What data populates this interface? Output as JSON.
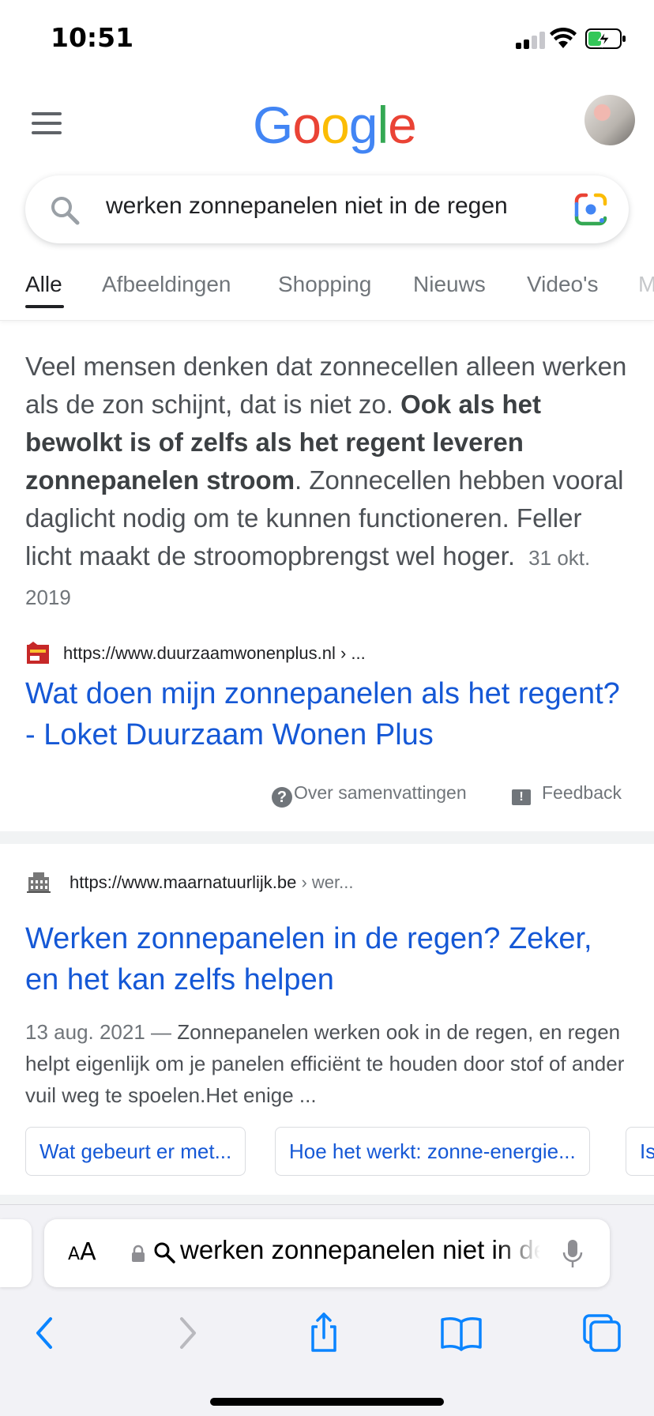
{
  "status_bar": {
    "time": "10:51"
  },
  "header": {
    "logo_letters": [
      {
        "char": "G",
        "color": "#4285f4"
      },
      {
        "char": "o",
        "color": "#ea4335"
      },
      {
        "char": "o",
        "color": "#fbbc05"
      },
      {
        "char": "g",
        "color": "#4285f4"
      },
      {
        "char": "l",
        "color": "#34a853"
      },
      {
        "char": "e",
        "color": "#ea4335"
      }
    ]
  },
  "search": {
    "query": "werken zonnepanelen niet in de regen"
  },
  "tabs": [
    "Alle",
    "Afbeeldingen",
    "Shopping",
    "Nieuws",
    "Video's",
    "M"
  ],
  "featured_snippet": {
    "text_before": "Veel mensen denken dat zonnecellen alleen werken als de zon schijnt, dat is niet zo. ",
    "bold": "Ook als het bewolkt is of zelfs als het regent leveren zonnepanelen stroom",
    "text_after": ". Zonnecellen hebben vooral daglicht nodig om te kunnen functioneren. Feller licht maakt de stroomopbrengst wel hoger.",
    "date": "31 okt. 2019",
    "source_url": "https://www.duurzaamwonenplus.nl",
    "source_crumb": " › ...",
    "title": "Wat doen mijn zonnepanelen als het regent? - Loket Duurzaam Wonen Plus",
    "about_label": "Over samenvattingen",
    "feedback_label": "Feedback"
  },
  "result2": {
    "source_url": "https://www.maarnatuurlijk.be",
    "source_crumb": " › wer...",
    "title": "Werken zonnepanelen in de regen? Zeker, en het kan zelfs helpen",
    "date": "13 aug. 2021",
    "separator": " — ",
    "description": "Zonnepanelen werken ook in de regen, en regen helpt eigenlijk om je panelen efficiënt te houden door stof of ander vuil weg te spoelen.Het enige ...",
    "chips": [
      "Wat gebeurt er met...",
      "Hoe het werkt: zonne-energie...",
      "Is"
    ]
  },
  "safari": {
    "aa_large": "A",
    "aa_small": "A",
    "address_text": "werken zonnepanelen niet in de regen"
  }
}
